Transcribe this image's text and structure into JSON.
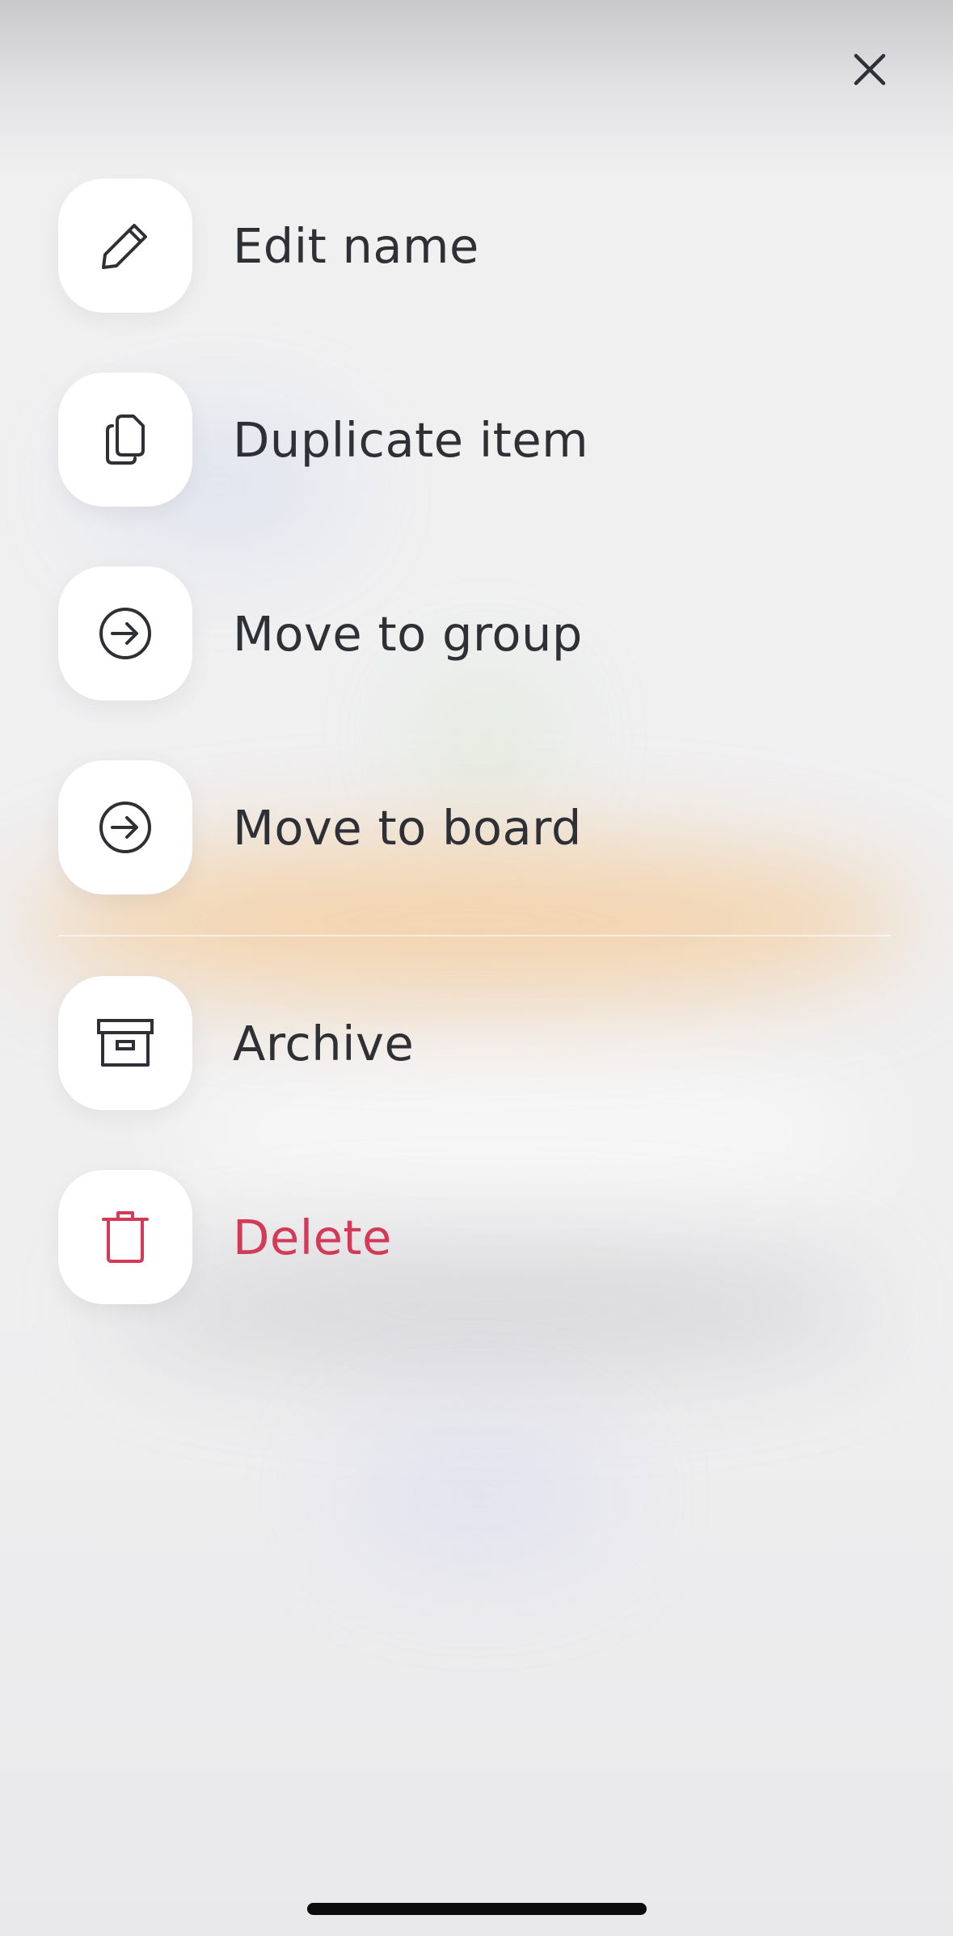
{
  "menu": {
    "items": [
      {
        "label": "Edit name",
        "icon": "pencil-icon"
      },
      {
        "label": "Duplicate item",
        "icon": "copy-icon"
      },
      {
        "label": "Move to group",
        "icon": "arrow-right-circle-icon"
      },
      {
        "label": "Move to board",
        "icon": "arrow-right-circle-icon"
      },
      {
        "label": "Archive",
        "icon": "archive-box-icon"
      },
      {
        "label": "Delete",
        "icon": "trash-icon"
      }
    ]
  },
  "colors": {
    "text": "#2f2f36",
    "danger": "#d33a58",
    "tile": "#ffffff"
  },
  "close": {
    "icon": "close-icon"
  }
}
